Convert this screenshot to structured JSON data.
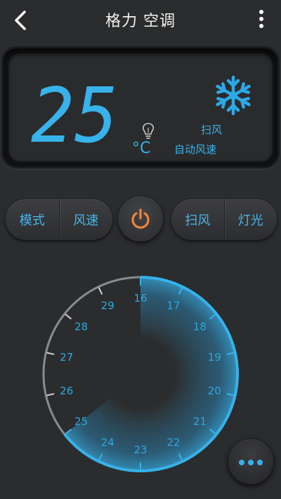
{
  "header": {
    "title": "格力 空调",
    "back_icon": "chevron-left-icon",
    "menu_icon": "more-vertical-icon"
  },
  "display": {
    "temperature": "25",
    "unit": "°C",
    "mode_icon": "snowflake-icon",
    "status_icon": "lightbulb-icon",
    "swing_status": "扫风",
    "fan_status": "自动风速"
  },
  "controls": {
    "mode_label": "模式",
    "fan_speed_label": "风速",
    "swing_label": "扫风",
    "light_label": "灯光",
    "power_icon": "power-icon"
  },
  "dial": {
    "temperatures": [
      "16",
      "17",
      "18",
      "19",
      "20",
      "21",
      "22",
      "23",
      "24",
      "25",
      "26",
      "27",
      "28",
      "29"
    ],
    "selected": "25"
  },
  "more_button": {
    "icon": "more-horizontal-icon"
  },
  "colors": {
    "accent": "#37b2ea",
    "power": "#f0823a",
    "background": "#2b2c2e"
  }
}
